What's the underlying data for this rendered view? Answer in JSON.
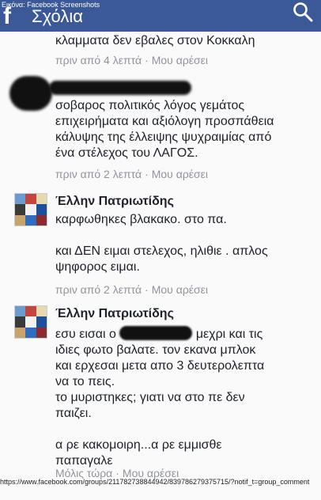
{
  "header": {
    "caption": "Εικόνα: Facebook Screenshots",
    "title": "Σχόλια",
    "logo": "f",
    "search_icon": "search-icon",
    "bg_color": "#3b5998"
  },
  "comments": [
    {
      "lines": [
        "κλαμματα δεν εβαλες στον Κοκκαλη"
      ],
      "time": "πριν από 4 λεπτά",
      "like": "Μου αρέσει"
    },
    {
      "author": "",
      "lines": [
        "σοβαρος πολιτικός λόγος γεμάτος",
        "επιχειρήματα και αξιόλογη προσπάθεια",
        "κάλυψης της έλλειψης ψυχραιμίας από",
        "ένα στέλεχος του ΛΑΓΟΣ."
      ],
      "time": "πριν από 2 λεπτά",
      "like": "Μου αρέσει"
    },
    {
      "author": "Έλλην Πατριωτίδης",
      "lines": [
        "καρφωθηκες βλακακο. στο πα.",
        "",
        "και ΔΕΝ ειμαι στελεχος, ηλιθιε . απλος",
        "ψηφορος ειμαι."
      ],
      "time": "πριν από 2 λεπτά",
      "like": "Μου αρέσει"
    },
    {
      "author": "Έλλην Πατριωτίδης",
      "line1_a": "εσυ εισαι ο",
      "line1_b": "μεχρι και τις",
      "lines": [
        "ιδιες φωτο βαλατε. τον εκανα μπλοκ",
        "και ερχεσαι μετα απο 3 δευτερολεπτα",
        "να το πεις.",
        "το μυριστηκες; γιατι να στο πε δεν",
        "παιζει.",
        "",
        "α ρε κακομοιρη...α ρε εμμισθε",
        "παπαγαλε"
      ],
      "time": "Μόλις τώρα",
      "like": "Μου αρέσει"
    }
  ],
  "status_url": "https://www.facebook.com/groups/211782738844942/839786279375715/?notif_t=group_comment"
}
